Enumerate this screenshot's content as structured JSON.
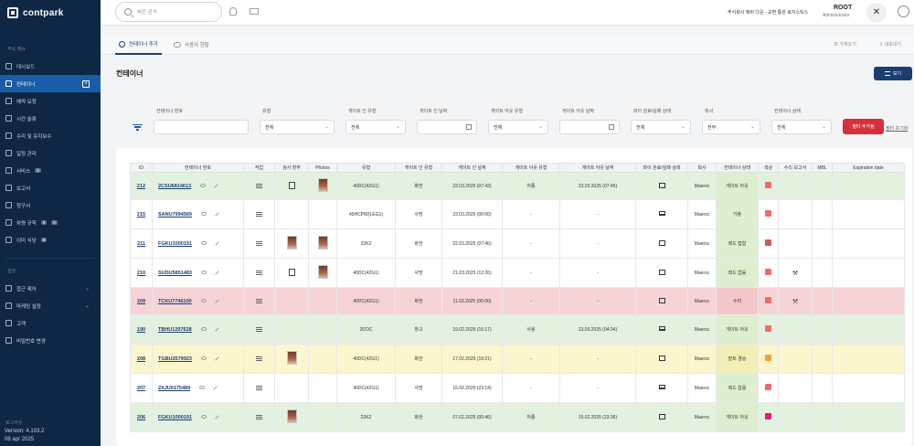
{
  "app": {
    "logo": "contpark"
  },
  "sidebar": {
    "section_main": "주요 메뉴",
    "items": [
      {
        "label": "대시보드",
        "active": false
      },
      {
        "label": "컨테이너",
        "active": true
      },
      {
        "label": "예약 요청",
        "active": false
      },
      {
        "label": "시간 슬롯",
        "active": false
      },
      {
        "label": "수리 및 유지보수",
        "active": false
      },
      {
        "label": "일정 관리",
        "active": false
      },
      {
        "label": "서비스",
        "badge": "3",
        "active": false
      },
      {
        "label": "보고서",
        "active": false
      },
      {
        "label": "청구서",
        "active": false
      },
      {
        "label": "차량 규칙",
        "badge": "3",
        "badge2": "0",
        "active": false
      },
      {
        "label": "이미 식당",
        "badge": "8",
        "active": false
      }
    ],
    "section_settings": "설정",
    "settings_items": [
      {
        "label": "접근 제어"
      },
      {
        "label": "마케팅 설정"
      },
      {
        "label": "고객"
      },
      {
        "label": "비밀번호 변경"
      }
    ],
    "logout": "로그아웃",
    "version": "Version: 4.103.2",
    "date": "08 apr 2025"
  },
  "topbar": {
    "search_placeholder": "빠른 검색",
    "company": "주식회사 에버 다운 - 교환 통관 로지스틱스",
    "user_name": "ROOT",
    "user_role": "Administrator",
    "close": "✕"
  },
  "tabs": {
    "active": "컨테이너 추가",
    "second": "사용자 현황",
    "link1": "가져오기",
    "link2": "내보내기"
  },
  "page": {
    "title": "컨테이너",
    "dropdown_label": "보기"
  },
  "filters": {
    "labels": [
      "컨테이너 번호",
      "유형",
      "게이트 인 유형",
      "게이트 인 날짜",
      "게이트 아웃 유형",
      "게이트 아웃 날짜",
      "파이 원료/실패 상태",
      "회사",
      "컨테이너 상태"
    ],
    "values": [
      "",
      "전체",
      "전체",
      "",
      "전체",
      "",
      "전체",
      "전부",
      "전체"
    ],
    "apply": "필터 추가됨",
    "reset": "필터 초기화"
  },
  "table": {
    "headers": [
      "ID",
      "컨테이너 번호",
      "작업",
      "검사 양부",
      "Photos",
      "유형",
      "게이트 인 유형",
      "게이트 인 날짜",
      "게이트 아웃 유형",
      "게이트 아웃 날짜",
      "파이 원료/실패 상태",
      "회사",
      "컨테이너 상태",
      "색상",
      "수리 보고서",
      "MBL",
      "Expiration date"
    ],
    "rows": [
      {
        "id": "212",
        "container": "2CSU6814613",
        "doc": true,
        "photo": true,
        "type": "40DC(42G1)",
        "gin_type": "화한",
        "gin_date": "23.03.2025 (07:43)",
        "gout_type": "처종",
        "gout_date": "23.03.2025 (07:45)",
        "dmg": "box",
        "company": "Maersc",
        "status": "게이트 아웃",
        "color": "#ef6b6b",
        "repair": "",
        "row_style": "green"
      },
      {
        "id": "215",
        "container": "SANU7994569",
        "doc": false,
        "photo": false,
        "type": "45HCPW(LEG1)",
        "gin_type": "사망",
        "gin_date": "23.03.2025 (00:00)",
        "gout_type": "-",
        "gout_date": "-",
        "dmg": "screen",
        "company": "Maersc",
        "status": "거봉",
        "color": "#ef6b6b",
        "repair": "",
        "row_style": "white"
      },
      {
        "id": "211",
        "container": "FGKU1000191",
        "doc": false,
        "photo": true,
        "photo_in_doc": true,
        "type": "22K2",
        "gin_type": "화한",
        "gin_date": "22.03.2025 (07:46)",
        "gout_type": "-",
        "gout_date": "-",
        "dmg": "box",
        "company": "Maersc",
        "status": "레드 접합",
        "color": "#c95b5b",
        "repair": "",
        "row_style": "white"
      },
      {
        "id": "210",
        "container": "SUDU5851483",
        "doc": true,
        "photo": true,
        "type": "40DC(42G1)",
        "gin_type": "사망",
        "gin_date": "21.03.2025 (12:26)",
        "gout_type": "-",
        "gout_date": "-",
        "dmg": "box",
        "company": "Maersc",
        "status": "레드 없음",
        "color": "#ef6b6b",
        "repair": "⚒",
        "row_style": "white"
      },
      {
        "id": "209",
        "container": "TCKU7746100",
        "doc": false,
        "photo": false,
        "type": "40DC(42G1)",
        "gin_type": "화한",
        "gin_date": "11.03.2025 (00:00)",
        "gout_type": "-",
        "gout_date": "-",
        "dmg": "box",
        "company": "Maersc",
        "status": "수리",
        "color": "#ef6b6b",
        "repair": "⚒",
        "row_style": "red"
      },
      {
        "id": "190",
        "container": "TBHU1297628",
        "doc": false,
        "photo": false,
        "type": "20'DC",
        "gin_type": "창고",
        "gin_date": "19.02.2025 (16:17)",
        "gout_type": "사용",
        "gout_date": "23.03.2025 (04:34)",
        "dmg": "screen",
        "company": "Maersc",
        "status": "게이트 아웃",
        "color": "#ef6b6b",
        "repair": "",
        "row_style": "green"
      },
      {
        "id": "208",
        "container": "TGBU2579923",
        "doc": false,
        "photo": true,
        "photo_in_doc": true,
        "type": "40DC(42G1)",
        "gin_type": "화한",
        "gin_date": "17.02.2025 (19:21)",
        "gout_type": "-",
        "gout_date": "-",
        "dmg": "box",
        "company": "Maersc",
        "status": "발트 결승",
        "color": "#f2a33a",
        "repair": "",
        "row_style": "yellow"
      },
      {
        "id": "207",
        "container": "2XJU0175489",
        "doc": false,
        "photo": false,
        "type": "40DC(42G1)",
        "gin_type": "사망",
        "gin_date": "15.02.2025 (23:14)",
        "gout_type": "-",
        "gout_date": "-",
        "dmg": "screen",
        "company": "Maersc",
        "status": "레드 없음",
        "color": "#ef6b6b",
        "repair": "",
        "row_style": "white"
      },
      {
        "id": "206",
        "container": "FGKU1000191",
        "doc": false,
        "photo": true,
        "photo_in_doc": true,
        "type": "22K2",
        "gin_type": "화한",
        "gin_date": "07.02.2025 (00:46)",
        "gout_type": "처종",
        "gout_date": "15.02.2025 (23:36)",
        "dmg": "box",
        "company": "Maersc",
        "status": "게이트 아웃",
        "color": "#e8187a",
        "repair": "",
        "row_style": "green"
      }
    ]
  },
  "colors": {
    "sidebar_bg": "#0d2745",
    "accent": "#1a3e72",
    "danger": "#d6303b"
  }
}
